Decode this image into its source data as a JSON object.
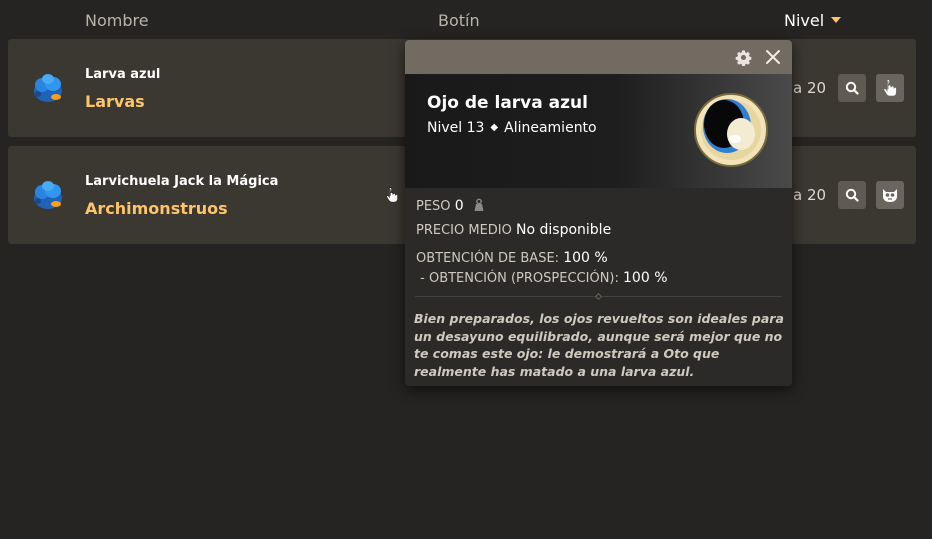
{
  "header": {
    "name_label": "Nombre",
    "loot_label": "Botín",
    "level_label": "Nivel"
  },
  "rows": [
    {
      "name": "Larva azul",
      "family": "Larvas",
      "level_text": "a 20"
    },
    {
      "name": "Larvichuela Jack la Mágica",
      "family": "Archimonstruos",
      "level_text": "a 20"
    }
  ],
  "popup": {
    "title": "Ojo de larva azul",
    "level": "Nivel 13",
    "separator": "◆",
    "category": "Alineamiento",
    "weight_label": "PESO",
    "weight_value": "0",
    "price_label": "PRECIO MEDIO",
    "price_value": "No disponible",
    "base_label": "OBTENCIÓN DE BASE:",
    "base_value": "100 %",
    "prosp_label": " - OBTENCIÓN (PROSPECCIÓN):",
    "prosp_value": "100 %",
    "description": "Bien preparados, los ojos revueltos son ideales para un desayuno equilibrado, aunque será mejor que no te comas este ojo: le demostrará a Oto que realmente has matado a una larva azul."
  },
  "colors": {
    "accent": "#ffc469",
    "row_bg": "#3b3731",
    "page_bg": "#252422"
  }
}
